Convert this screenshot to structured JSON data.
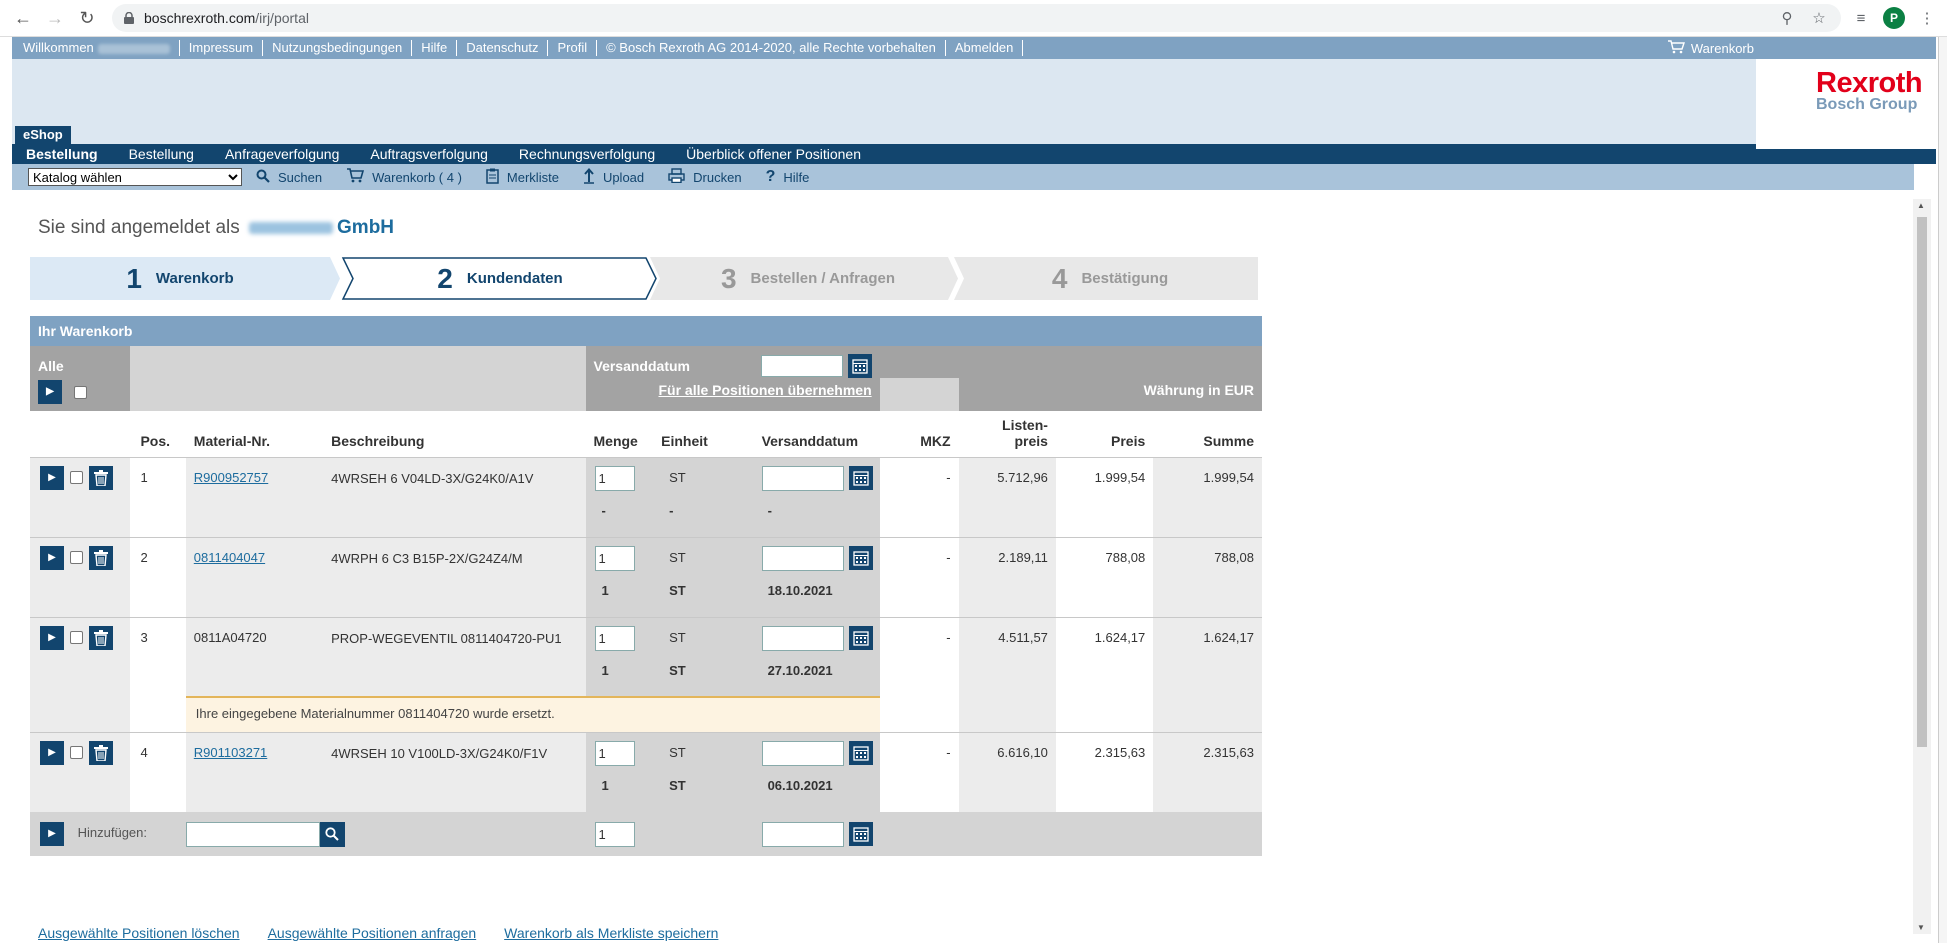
{
  "browser": {
    "url_host": "boschrexroth.com",
    "url_path": "/irj/portal",
    "profile_initial": "P"
  },
  "topnav": {
    "items": [
      "Willkommen",
      "Impressum",
      "Nutzungsbedingungen",
      "Hilfe",
      "Datenschutz",
      "Profil",
      "© Bosch Rexroth AG 2014-2020, alle Rechte vorbehalten",
      "Abmelden"
    ],
    "cart": "Warenkorb"
  },
  "logo": {
    "brand": "Rexroth",
    "group": "Bosch Group"
  },
  "eshop_tab": "eShop",
  "mainnav": [
    "Bestellung",
    "Bestellung",
    "Anfrageverfolgung",
    "Auftragsverfolgung",
    "Rechnungsverfolgung",
    "Überblick offener Positionen"
  ],
  "toolbar": {
    "catalog_select": "Katalog wählen",
    "search": "Suchen",
    "cart": "Warenkorb ( 4 )",
    "memo": "Merkliste",
    "upload": "Upload",
    "print": "Drucken",
    "help": "Hilfe"
  },
  "login": {
    "prefix": "Sie sind angemeldet als",
    "company_suffix": "GmbH"
  },
  "steps": [
    {
      "num": "1",
      "label": "Warenkorb"
    },
    {
      "num": "2",
      "label": "Kundendaten"
    },
    {
      "num": "3",
      "label": "Bestellen / Anfragen"
    },
    {
      "num": "4",
      "label": "Bestätigung"
    }
  ],
  "cart": {
    "title": "Ihr Warenkorb",
    "all_label": "Alle",
    "ship_date_label": "Versanddatum",
    "apply_all": "Für alle Positionen übernehmen",
    "currency": "Währung in EUR",
    "columns": {
      "pos": "Pos.",
      "material": "Material-Nr.",
      "description": "Beschreibung",
      "qty": "Menge",
      "unit": "Einheit",
      "ship": "Versanddatum",
      "mkz": "MKZ",
      "list_price_1": "Listen-",
      "list_price_2": "preis",
      "price": "Preis",
      "sum": "Summe"
    },
    "rows": [
      {
        "pos": "1",
        "material": "R900952757",
        "material_link": true,
        "desc": "4WRSEH 6 V04LD-3X/G24K0/A1V",
        "qty": "1",
        "unit": "ST",
        "mkz": "-",
        "list_price": "5.712,96",
        "price": "1.999,54",
        "sum": "1.999,54",
        "confirm_qty": "-",
        "confirm_unit": "-",
        "confirm_date": "-",
        "note": ""
      },
      {
        "pos": "2",
        "material": "0811404047",
        "material_link": true,
        "desc": "4WRPH 6 C3 B15P-2X/G24Z4/M",
        "qty": "1",
        "unit": "ST",
        "mkz": "-",
        "list_price": "2.189,11",
        "price": "788,08",
        "sum": "788,08",
        "confirm_qty": "1",
        "confirm_unit": "ST",
        "confirm_date": "18.10.2021",
        "note": ""
      },
      {
        "pos": "3",
        "material": "0811A04720",
        "material_link": false,
        "desc": "PROP-WEGEVENTIL 0811404720-PU1",
        "qty": "1",
        "unit": "ST",
        "mkz": "-",
        "list_price": "4.511,57",
        "price": "1.624,17",
        "sum": "1.624,17",
        "confirm_qty": "1",
        "confirm_unit": "ST",
        "confirm_date": "27.10.2021",
        "note": "Ihre eingegebene Materialnummer 0811404720 wurde ersetzt."
      },
      {
        "pos": "4",
        "material": "R901103271",
        "material_link": true,
        "desc": "4WRSEH 10 V100LD-3X/G24K0/F1V",
        "qty": "1",
        "unit": "ST",
        "mkz": "-",
        "list_price": "6.616,10",
        "price": "2.315,63",
        "sum": "2.315,63",
        "confirm_qty": "1",
        "confirm_unit": "ST",
        "confirm_date": "06.10.2021",
        "note": ""
      }
    ],
    "add_label": "Hinzufügen:",
    "add_qty": "1"
  },
  "bottom_links": [
    "Ausgewählte Positionen löschen",
    "Ausgewählte Positionen anfragen",
    "Warenkorb als Merkliste speichern"
  ],
  "colors": {
    "navy": "#12456e",
    "header_blue": "#7fa2c2",
    "link": "#1d6c9e",
    "brand_red": "#e2001a",
    "step_active": "#dce9f5"
  }
}
